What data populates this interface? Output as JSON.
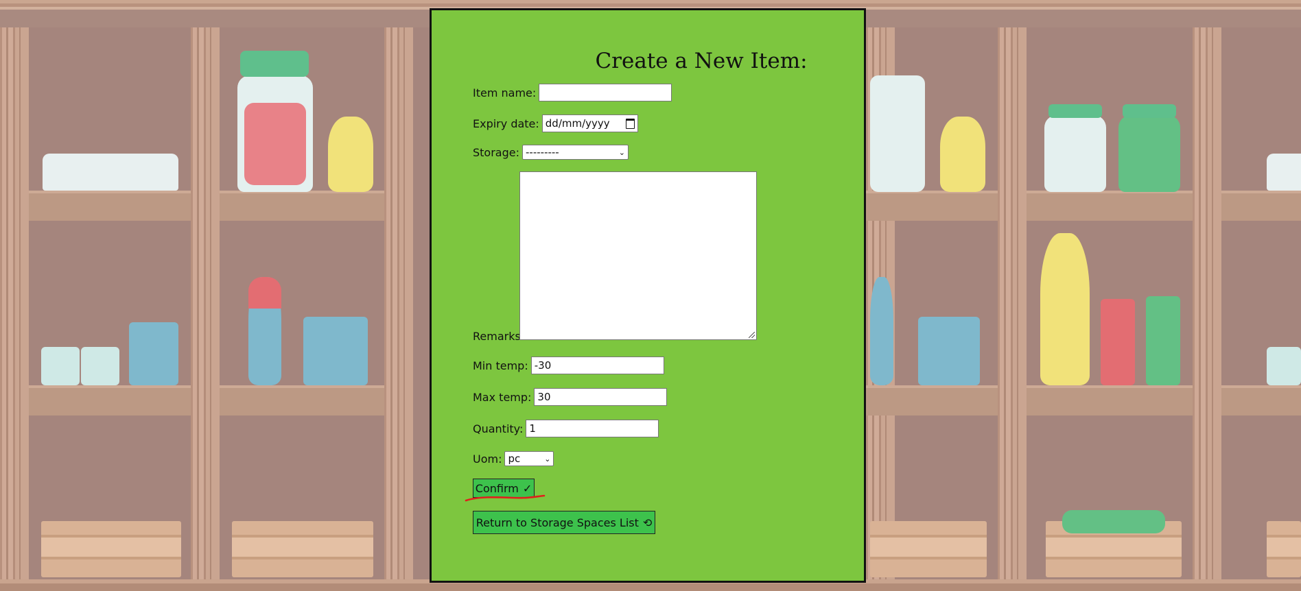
{
  "form": {
    "title": "Create a New Item:",
    "item_name": {
      "label": "Item name:",
      "value": ""
    },
    "expiry_date": {
      "label": "Expiry date:",
      "value": "dd/mm/yyyy"
    },
    "storage": {
      "label": "Storage:",
      "selected": "---------"
    },
    "remarks": {
      "label": "Remarks:",
      "value": ""
    },
    "min_temp": {
      "label": "Min temp:",
      "value": "-30"
    },
    "max_temp": {
      "label": "Max temp:",
      "value": "30"
    },
    "quantity": {
      "label": "Quantity:",
      "value": "1"
    },
    "uom": {
      "label": "Uom:",
      "selected": "pc"
    },
    "confirm_label": "Confirm",
    "return_label": "Return to Storage Spaces List"
  },
  "icons": {
    "confirm": "checkmark-icon",
    "return": "refresh-icon",
    "calendar": "calendar-icon",
    "select_arrow": "chevron-down-icon"
  },
  "colors": {
    "panel": "#7dc63f",
    "button": "#3dc24c",
    "annotation": "#e0201c",
    "background": "#a5857d"
  }
}
